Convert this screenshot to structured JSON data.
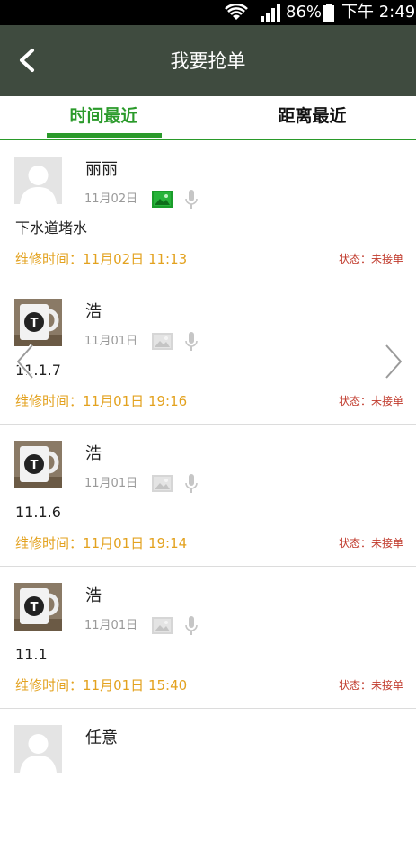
{
  "status_bar": {
    "battery": "86%",
    "time": "下午 2:49"
  },
  "header": {
    "title": "我要抢单"
  },
  "tabs": [
    {
      "label": "时间最近"
    },
    {
      "label": "距离最近"
    }
  ],
  "orders": [
    {
      "name": "丽丽",
      "date": "11月02日",
      "description": "下水道堵水",
      "repair_time": "维修时间：11月02日 11:13",
      "status": "状态：未接单",
      "avatar": "blank-person",
      "has_image": true
    },
    {
      "name": "浩",
      "date": "11月01日",
      "description": "11.1.7",
      "repair_time": "维修时间：11月01日 19:16",
      "status": "状态：未接单",
      "avatar": "mug-photo",
      "has_image": false
    },
    {
      "name": "浩",
      "date": "11月01日",
      "description": "11.1.6",
      "repair_time": "维修时间：11月01日 19:14",
      "status": "状态：未接单",
      "avatar": "mug-photo",
      "has_image": false
    },
    {
      "name": "浩",
      "date": "11月01日",
      "description": "11.1",
      "repair_time": "维修时间：11月01日 15:40",
      "status": "状态：未接单",
      "avatar": "mug-photo",
      "has_image": false
    },
    {
      "name": "任意",
      "date": "",
      "description": "",
      "repair_time": "",
      "status": "",
      "avatar": "blank-person",
      "has_image": false
    }
  ],
  "colors": {
    "header_bg": "#3f4b3f",
    "accent": "#2a9a2a",
    "repair_time": "#e3a21f",
    "status": "#c0392b"
  }
}
